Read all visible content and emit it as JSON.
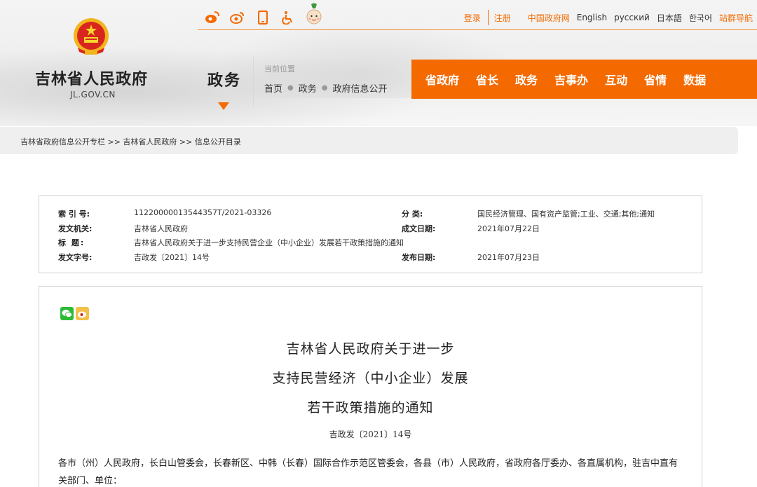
{
  "topbar": {
    "icons": [
      "weibo-icon",
      "weibo-icon",
      "mobile-icon",
      "accessibility-icon",
      "mascot-icon"
    ],
    "login": "登录",
    "register": "注册",
    "links": [
      "中国政府网",
      "English",
      "русский",
      "日本語",
      "한국어"
    ],
    "sitemap": "站群导航"
  },
  "logo": {
    "title": "吉林省人民政府",
    "domain": "JL.GOV.CN"
  },
  "section": {
    "title": "政务",
    "location_label": "当前位置",
    "breadcrumb": [
      "首页",
      "政务",
      "政府信息公开"
    ]
  },
  "mainnav": [
    "省政府",
    "省长",
    "政务",
    "吉事办",
    "互动",
    "省情",
    "数据"
  ],
  "crumbbar": {
    "text": "吉林省政府信息公开专栏 >> 吉林省人民政府 >> 信息公开目录"
  },
  "info": {
    "index_label": "索 引 号:",
    "index_value": "11220000013544357T/2021-03326",
    "category_label": "分 类:",
    "category_value": "国民经济管理、国有资产监管;工业、交通;其他;通知",
    "issuer_label": "发文机关:",
    "issuer_value": "吉林省人民政府",
    "written_label": "成文日期:",
    "written_value": "2021年07月22日",
    "title_label": "标 题:",
    "title_value": "吉林省人民政府关于进一步支持民营企业（中小企业）发展若干政策措施的通知",
    "docno_label": "发文字号:",
    "docno_value": "吉政发〔2021〕14号",
    "published_label": "发布日期:",
    "published_value": "2021年07月23日"
  },
  "article": {
    "title_lines": [
      "吉林省人民政府关于进一步",
      "支持民营经济（中小企业）发展",
      "若干政策措施的通知"
    ],
    "doc_no": "吉政发〔2021〕14号",
    "body": "各市（州）人民政府，长白山管委会，长春新区、中韩（长春）国际合作示范区管委会，各县（市）人民政府，省政府各厅委办、各直属机构，驻吉中直有关部门、单位："
  },
  "colors": {
    "accent": "#f46a00",
    "nav_bg": "#f46a00"
  }
}
